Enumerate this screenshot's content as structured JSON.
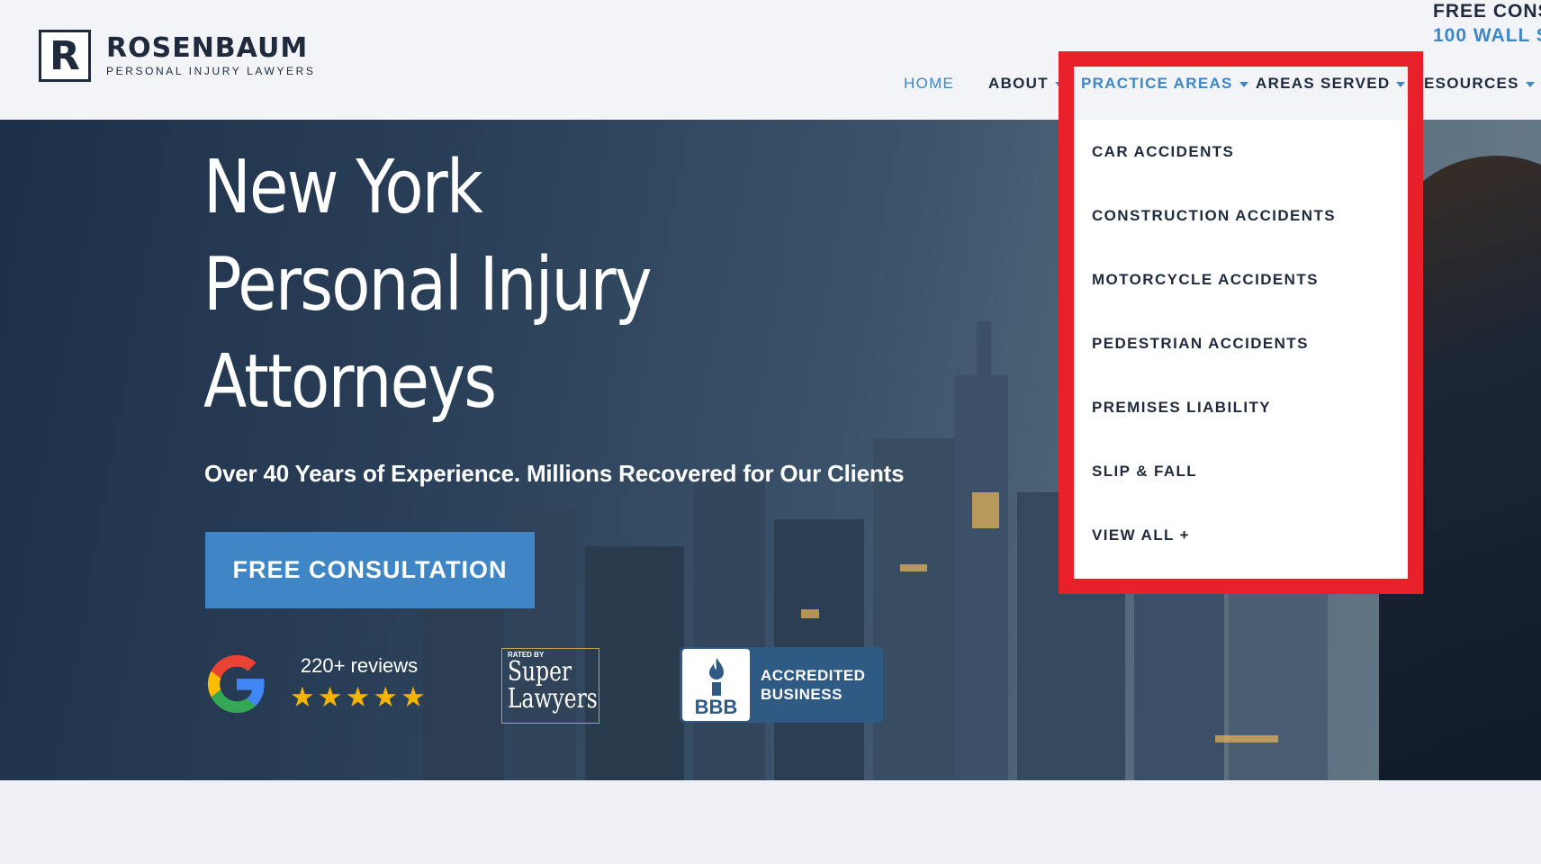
{
  "brand": {
    "name": "ROSENBAUM",
    "tagline": "PERSONAL INJURY LAWYERS",
    "monogram": "R"
  },
  "topbar": {
    "cta": "FREE CONS",
    "address": "100 WALL S"
  },
  "nav": {
    "home": "HOME",
    "about": "ABOUT",
    "practice_areas": "PRACTICE AREAS",
    "areas_served": "AREAS SERVED",
    "resources": "ESOURCES"
  },
  "practice_menu": {
    "items": [
      "CAR ACCIDENTS",
      "CONSTRUCTION ACCIDENTS",
      "MOTORCYCLE ACCIDENTS",
      "PEDESTRIAN ACCIDENTS",
      "PREMISES LIABILITY",
      "SLIP & FALL",
      "VIEW ALL +"
    ]
  },
  "hero": {
    "title_line1": "New York",
    "title_line2": "Personal Injury",
    "title_line3": "Attorneys",
    "subtitle": "Over 40 Years of Experience. Millions Recovered for Our Clients",
    "cta": "FREE CONSULTATION"
  },
  "badges": {
    "reviews_count": "220+ reviews",
    "stars": "★★★★★",
    "super_rated": "RATED BY",
    "super_line1": "Super",
    "super_line2": "Lawyers",
    "bbb_word": "BBB",
    "bbb_line1": "ACCREDITED",
    "bbb_line2": "BUSINESS"
  },
  "colors": {
    "accent": "#3e86c6",
    "navy": "#1f2a3c",
    "highlight": "#e8202a",
    "star": "#f4b400"
  }
}
